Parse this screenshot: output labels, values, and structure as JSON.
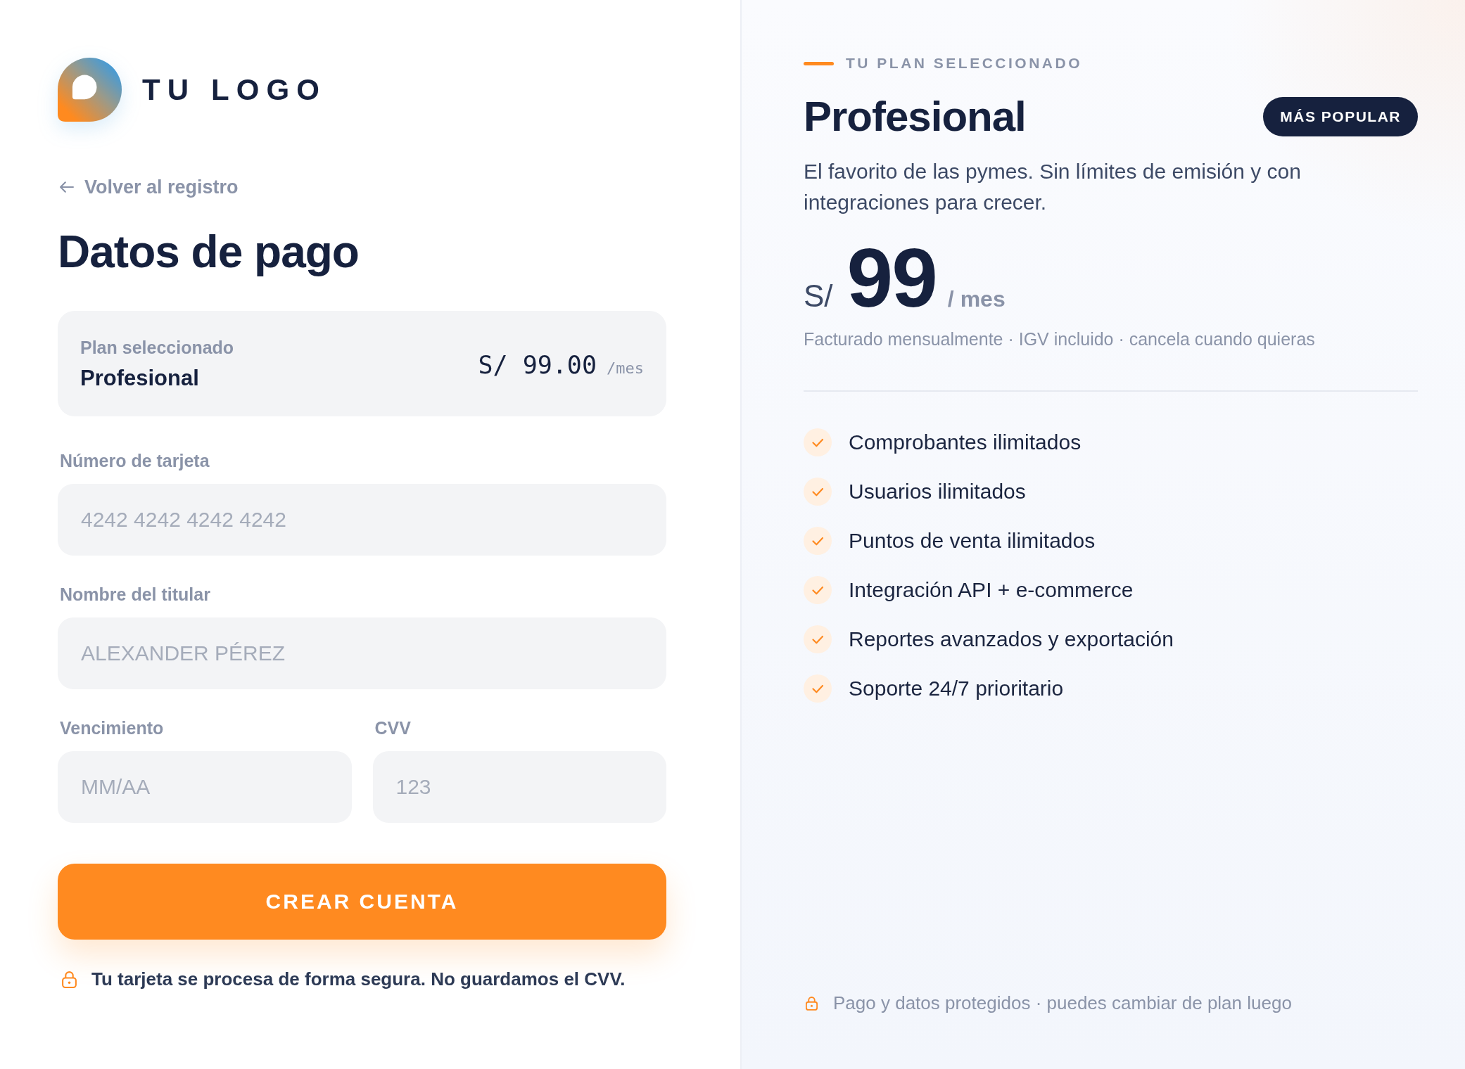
{
  "logo": {
    "text": "TU LOGO"
  },
  "back_link": {
    "label": "Volver al registro"
  },
  "title": "Datos de pago",
  "plan_summary": {
    "label": "Plan seleccionado",
    "name": "Profesional",
    "price": "S/ 99.00",
    "period": "/mes"
  },
  "form": {
    "rows": [
      {
        "fields": [
          {
            "label": "Número de tarjeta",
            "placeholder": "4242 4242 4242 4242"
          }
        ]
      },
      {
        "fields": [
          {
            "label": "Nombre del titular",
            "placeholder": "ALEXANDER PÉREZ"
          }
        ]
      },
      {
        "fields": [
          {
            "label": "Vencimiento",
            "placeholder": "MM/AA"
          },
          {
            "label": "CVV",
            "placeholder": "123"
          }
        ]
      }
    ],
    "submit_button": "CREAR CUENTA",
    "security_note": "Tu tarjeta se procesa de forma segura. No guardamos el CVV."
  },
  "plan_panel": {
    "eyebrow": "TU PLAN SELECCIONADO",
    "name": "Profesional",
    "badge": "MÁS POPULAR",
    "description": "El favorito de las pymes. Sin límites de emisión y con integraciones para crecer.",
    "price": {
      "currency": "S/",
      "amount": "99",
      "period": "/ mes"
    },
    "billing_note": "Facturado mensualmente · IGV incluido · cancela cuando quieras",
    "features": [
      "Comprobantes ilimitados",
      "Usuarios ilimitados",
      "Puntos de venta ilimitados",
      "Integración API + e-commerce",
      "Reportes avanzados y exportación",
      "Soporte 24/7 prioritario"
    ],
    "footer_note": "Pago y datos protegidos · puedes cambiar de plan luego"
  }
}
